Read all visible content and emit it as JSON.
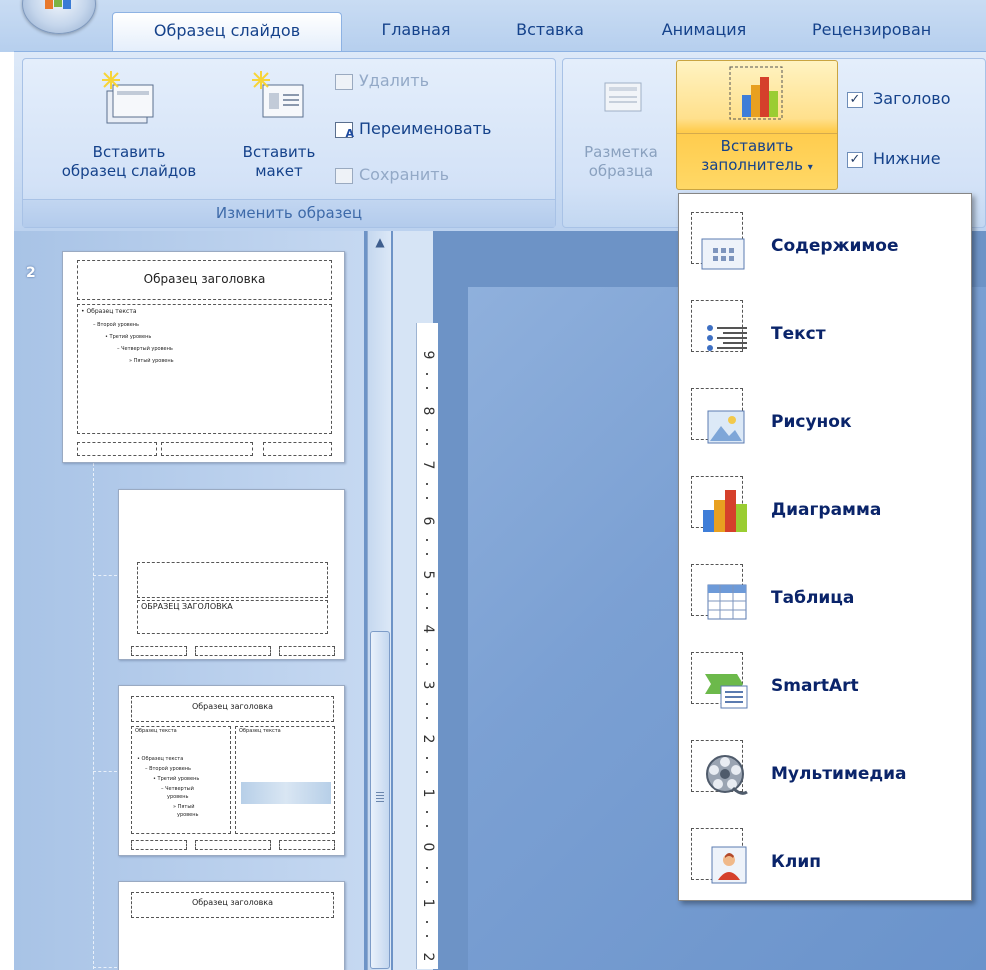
{
  "tabs": [
    {
      "label": "Образец слайдов",
      "active": true
    },
    {
      "label": "Главная",
      "active": false
    },
    {
      "label": "Вставка",
      "active": false
    },
    {
      "label": "Анимация",
      "active": false
    },
    {
      "label": "Рецензирован",
      "active": false
    }
  ],
  "ribbon": {
    "group_edit_master": {
      "label": "Изменить образец",
      "insert_slide_master": {
        "line1": "Вставить",
        "line2": "образец слайдов"
      },
      "insert_layout": {
        "line1": "Вставить",
        "line2": "макет"
      },
      "delete": "Удалить",
      "rename": "Переименовать",
      "preserve": "Сохранить"
    },
    "group_layout": {
      "master_layout": {
        "line1": "Разметка",
        "line2": "образца"
      },
      "insert_placeholder": {
        "line1": "Вставить",
        "line2": "заполнитель"
      },
      "title_checkbox": "Заголово",
      "footers_checkbox": "Нижние"
    }
  },
  "slides_pane": {
    "slide_number": "2",
    "thumb1": {
      "title": "Образец заголовка",
      "lines": [
        "Образец текста",
        "Второй уровень",
        "Третий уровень",
        "Четвертый уровень",
        "Пятый уровень"
      ]
    },
    "thumb2": {
      "title": "ОБРАЗЕЦ ЗАГОЛОВКА"
    },
    "thumb3": {
      "title": "Образец заголовка",
      "left_header": "Образец текста",
      "right_header": "Образец текста",
      "lines": [
        "Образец текста",
        "Второй уровень",
        "Третий уровень",
        "Четвертый",
        "уровень",
        "Пятый",
        "уровень"
      ]
    },
    "thumb4": {
      "title": "Образец заголовка"
    }
  },
  "ruler": {
    "numbers": [
      "9",
      "8",
      "7",
      "6",
      "5",
      "4",
      "3",
      "2",
      "1",
      "0",
      "1",
      "2"
    ]
  },
  "dropdown": {
    "items": [
      {
        "label": "Содержимое",
        "icon": "content-icon"
      },
      {
        "label": "Текст",
        "icon": "text-icon"
      },
      {
        "label": "Рисунок",
        "icon": "picture-icon"
      },
      {
        "label": "Диаграмма",
        "icon": "chart-icon"
      },
      {
        "label": "Таблица",
        "icon": "table-icon"
      },
      {
        "label": "SmartArt",
        "icon": "smartart-icon"
      },
      {
        "label": "Мультимедиа",
        "icon": "media-icon"
      },
      {
        "label": "Клип",
        "icon": "clipart-icon"
      }
    ]
  },
  "colors": {
    "ribbon": "#d3e2f7",
    "accent_hot": "#ffd866",
    "text": "#15428b"
  }
}
